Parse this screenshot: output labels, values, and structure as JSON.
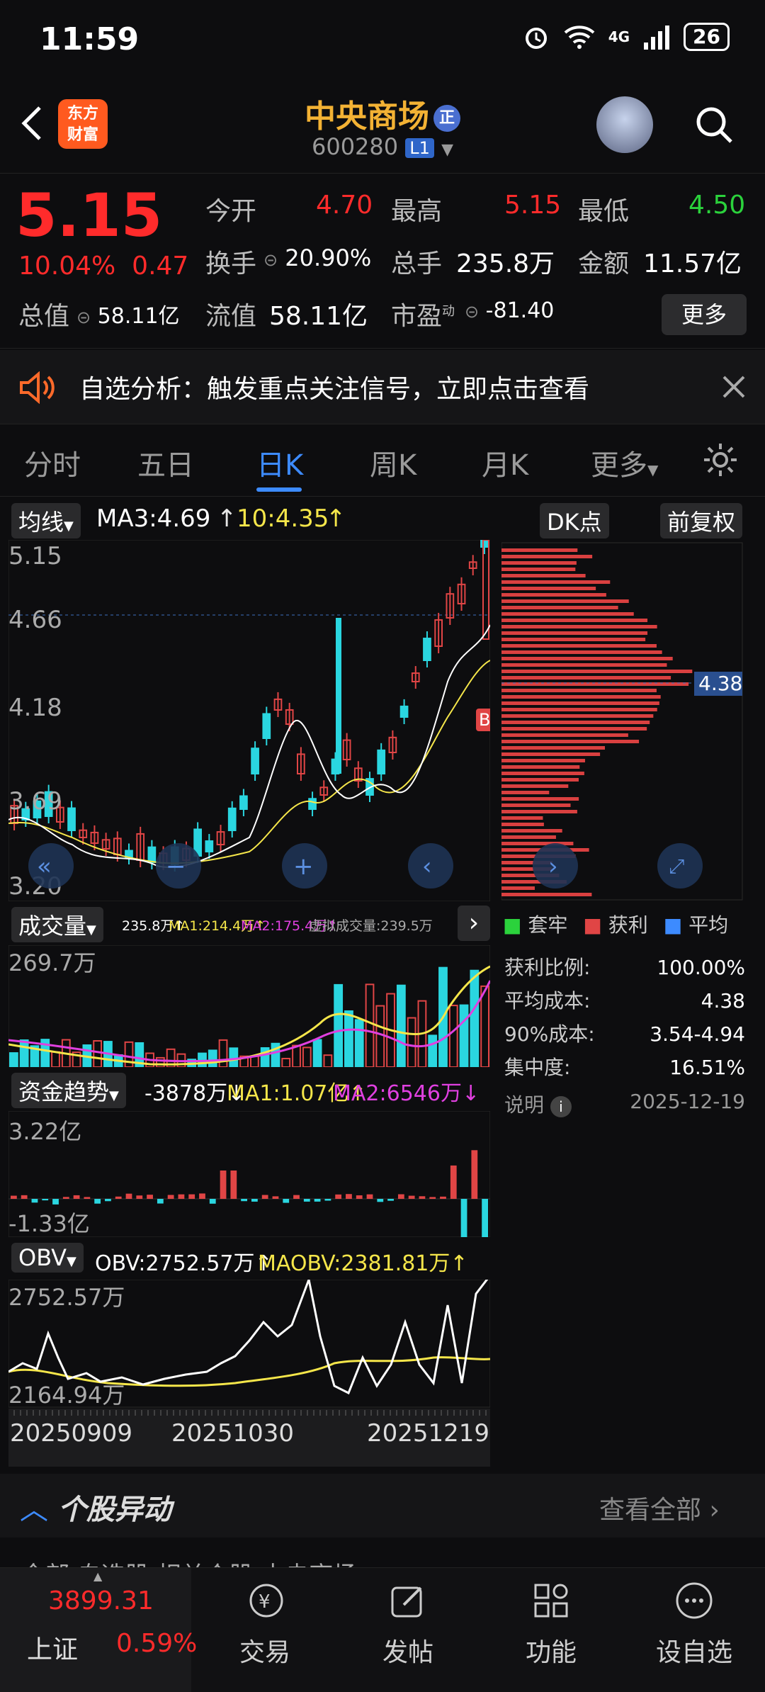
{
  "status": {
    "time": "11:59",
    "battery": "26",
    "network": "4G"
  },
  "header": {
    "logo_line1": "东方",
    "logo_line2": "财富",
    "title": "中央商场",
    "title_badge": "正",
    "code": "600280",
    "level": "L1"
  },
  "quote": {
    "price": "5.15",
    "change_pct": "10.04%",
    "change": "0.47",
    "open_label": "今开",
    "open": "4.70",
    "high_label": "最高",
    "high": "5.15",
    "low_label": "最低",
    "low": "4.50",
    "turnover_label": "换手",
    "turnover": "20.90%",
    "volume_label": "总手",
    "volume": "235.8万",
    "amount_label": "金额",
    "amount": "11.57亿",
    "mktcap_label": "总值",
    "mktcap": "58.11亿",
    "float_label": "流值",
    "float": "58.11亿",
    "pe_label": "市盈",
    "pe_sup": "动",
    "pe": "-81.40",
    "more": "更多"
  },
  "notice": {
    "text": "自选分析：触发重点关注信号，立即点击查看"
  },
  "tabs": [
    "分时",
    "五日",
    "日K",
    "周K",
    "月K",
    "更多"
  ],
  "chart": {
    "ma_label": "均线",
    "ma3": "MA3:4.69",
    "ma10": "10:4.35",
    "dk": "DK点",
    "fq": "前复权",
    "price_ticks": [
      "5.15",
      "4.66",
      "4.18",
      "3.69",
      "3.20"
    ],
    "cost_line": "4.38",
    "b_marker": "B",
    "vol_label": "成交量",
    "vol_info": "235.8万↑",
    "vol_ma1": "MA1:214.4万↑",
    "vol_ma2": "MA2:175.4万↑",
    "vol_virtual": "虚拟成交量:239.5万",
    "vol_tick": "269.7万",
    "fund_label": "资金趋势",
    "fund_info": "-3878万↓",
    "fund_ma1": "MA1:1.07亿↑",
    "fund_ma2": "MA2:6546万↓",
    "fund_ticks": [
      "3.22亿",
      "-1.33亿"
    ],
    "obv_label": "OBV",
    "obv_info": "OBV:2752.57万↑",
    "maobv_info": "MAOBV:2381.81万↑",
    "obv_ticks": [
      "2752.57万",
      "2164.94万"
    ],
    "dates": [
      "20250909",
      "20251030",
      "20251219"
    ]
  },
  "cost": {
    "legend": [
      "套牢",
      "获利",
      "平均"
    ],
    "rows": [
      {
        "k": "获利比例:",
        "v": "100.00%"
      },
      {
        "k": "平均成本:",
        "v": "4.38"
      },
      {
        "k": "90%成本:",
        "v": "3.54-4.94"
      },
      {
        "k": "集中度:",
        "v": "16.51%"
      }
    ],
    "note_label": "说明",
    "date": "2025-12-19"
  },
  "section": {
    "title": "个股异动",
    "view_all": "查看全部"
  },
  "subtabs_peek": "全部   自选股   相关个股   中央商场",
  "nav": {
    "index_name": "上证",
    "index_value": "3899.31",
    "index_pct": "0.59%",
    "items": [
      "交易",
      "发帖",
      "功能",
      "设自选"
    ]
  },
  "colors": {
    "up": "#ff2b2b",
    "down": "#2bd23c",
    "accent": "#3d8bff",
    "title": "#f3b234"
  }
}
